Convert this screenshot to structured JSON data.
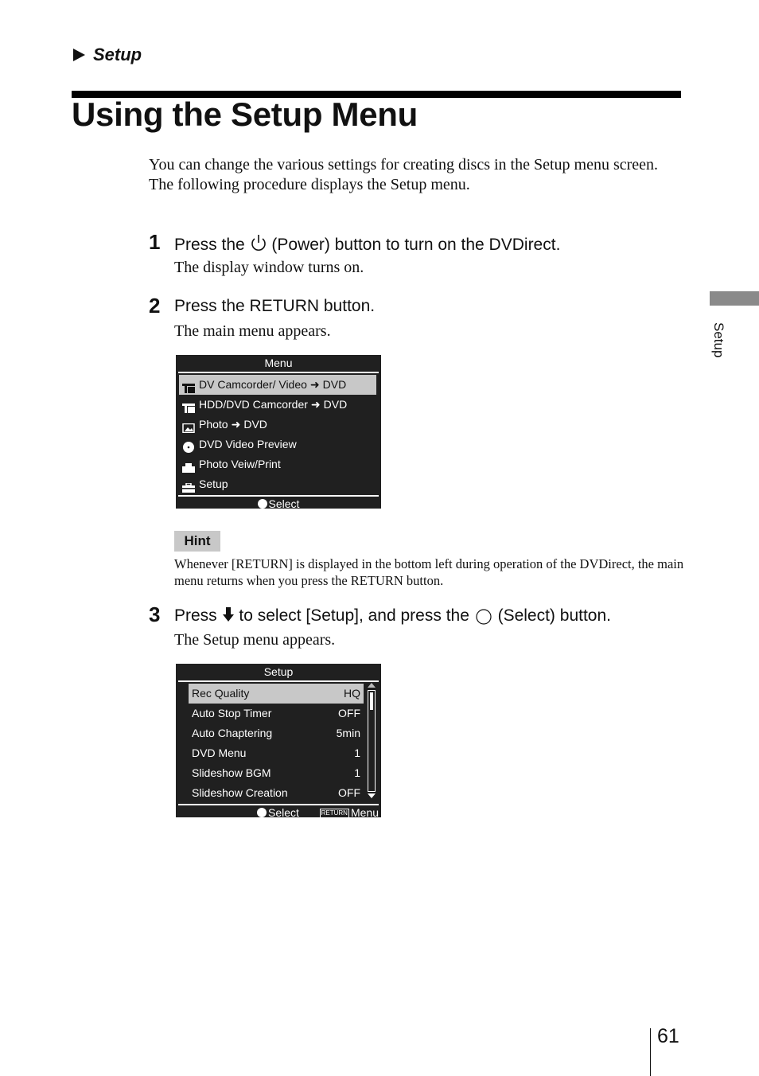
{
  "header": {
    "section": "Setup",
    "title": "Using the Setup Menu"
  },
  "intro": {
    "line1": "You can change the various settings for creating discs in the Setup menu screen.",
    "line2": "The following procedure displays the Setup menu."
  },
  "steps": [
    {
      "number": "1",
      "head_pre": "Press the",
      "head_icon": "power-icon",
      "head_post": "(Power) button to turn on the DVDirect.",
      "body": "The display window turns on."
    },
    {
      "number": "2",
      "head": "Press the RETURN button.",
      "body": "The main menu appears."
    },
    {
      "number": "3",
      "head_pre": "Press",
      "head_mid": "to select [Setup], and press the",
      "head_post": "(Select) button.",
      "body": "The Setup menu appears."
    }
  ],
  "main_menu": {
    "title": "Menu",
    "items": [
      {
        "icon": "camcorder-icon",
        "label": "DV Camcorder/ Video",
        "target": "DVD",
        "selected": true
      },
      {
        "icon": "camcorder-icon",
        "label": "HDD/DVD Camcorder",
        "target": "DVD",
        "selected": false
      },
      {
        "icon": "photo-icon",
        "label": "Photo",
        "target": "DVD",
        "selected": false
      },
      {
        "icon": "disc-icon",
        "label": "DVD Video Preview",
        "target": "",
        "selected": false
      },
      {
        "icon": "printer-icon",
        "label": "Photo Veiw/Print",
        "target": "",
        "selected": false
      },
      {
        "icon": "toolbox-icon",
        "label": "Setup",
        "target": "",
        "selected": false
      }
    ],
    "footer_select": "Select"
  },
  "hint": {
    "label": "Hint",
    "text": "Whenever [RETURN] is displayed in the bottom left during operation of the DVDirect, the main menu returns when you press the RETURN button."
  },
  "setup_menu": {
    "title": "Setup",
    "items": [
      {
        "label": "Rec Quality",
        "value": "HQ",
        "selected": true
      },
      {
        "label": "Auto Stop Timer",
        "value": "OFF",
        "selected": false
      },
      {
        "label": "Auto Chaptering",
        "value": "5min",
        "selected": false
      },
      {
        "label": "DVD Menu",
        "value": "1",
        "selected": false
      },
      {
        "label": "Slideshow BGM",
        "value": "1",
        "selected": false
      },
      {
        "label": "Slideshow Creation",
        "value": "OFF",
        "selected": false
      }
    ],
    "footer_select": "Select",
    "return_badge": "RETURN",
    "footer_menu": "Menu"
  },
  "side_tab": {
    "label": "Setup",
    "color": "#8a8a8a"
  },
  "page_number": "61"
}
